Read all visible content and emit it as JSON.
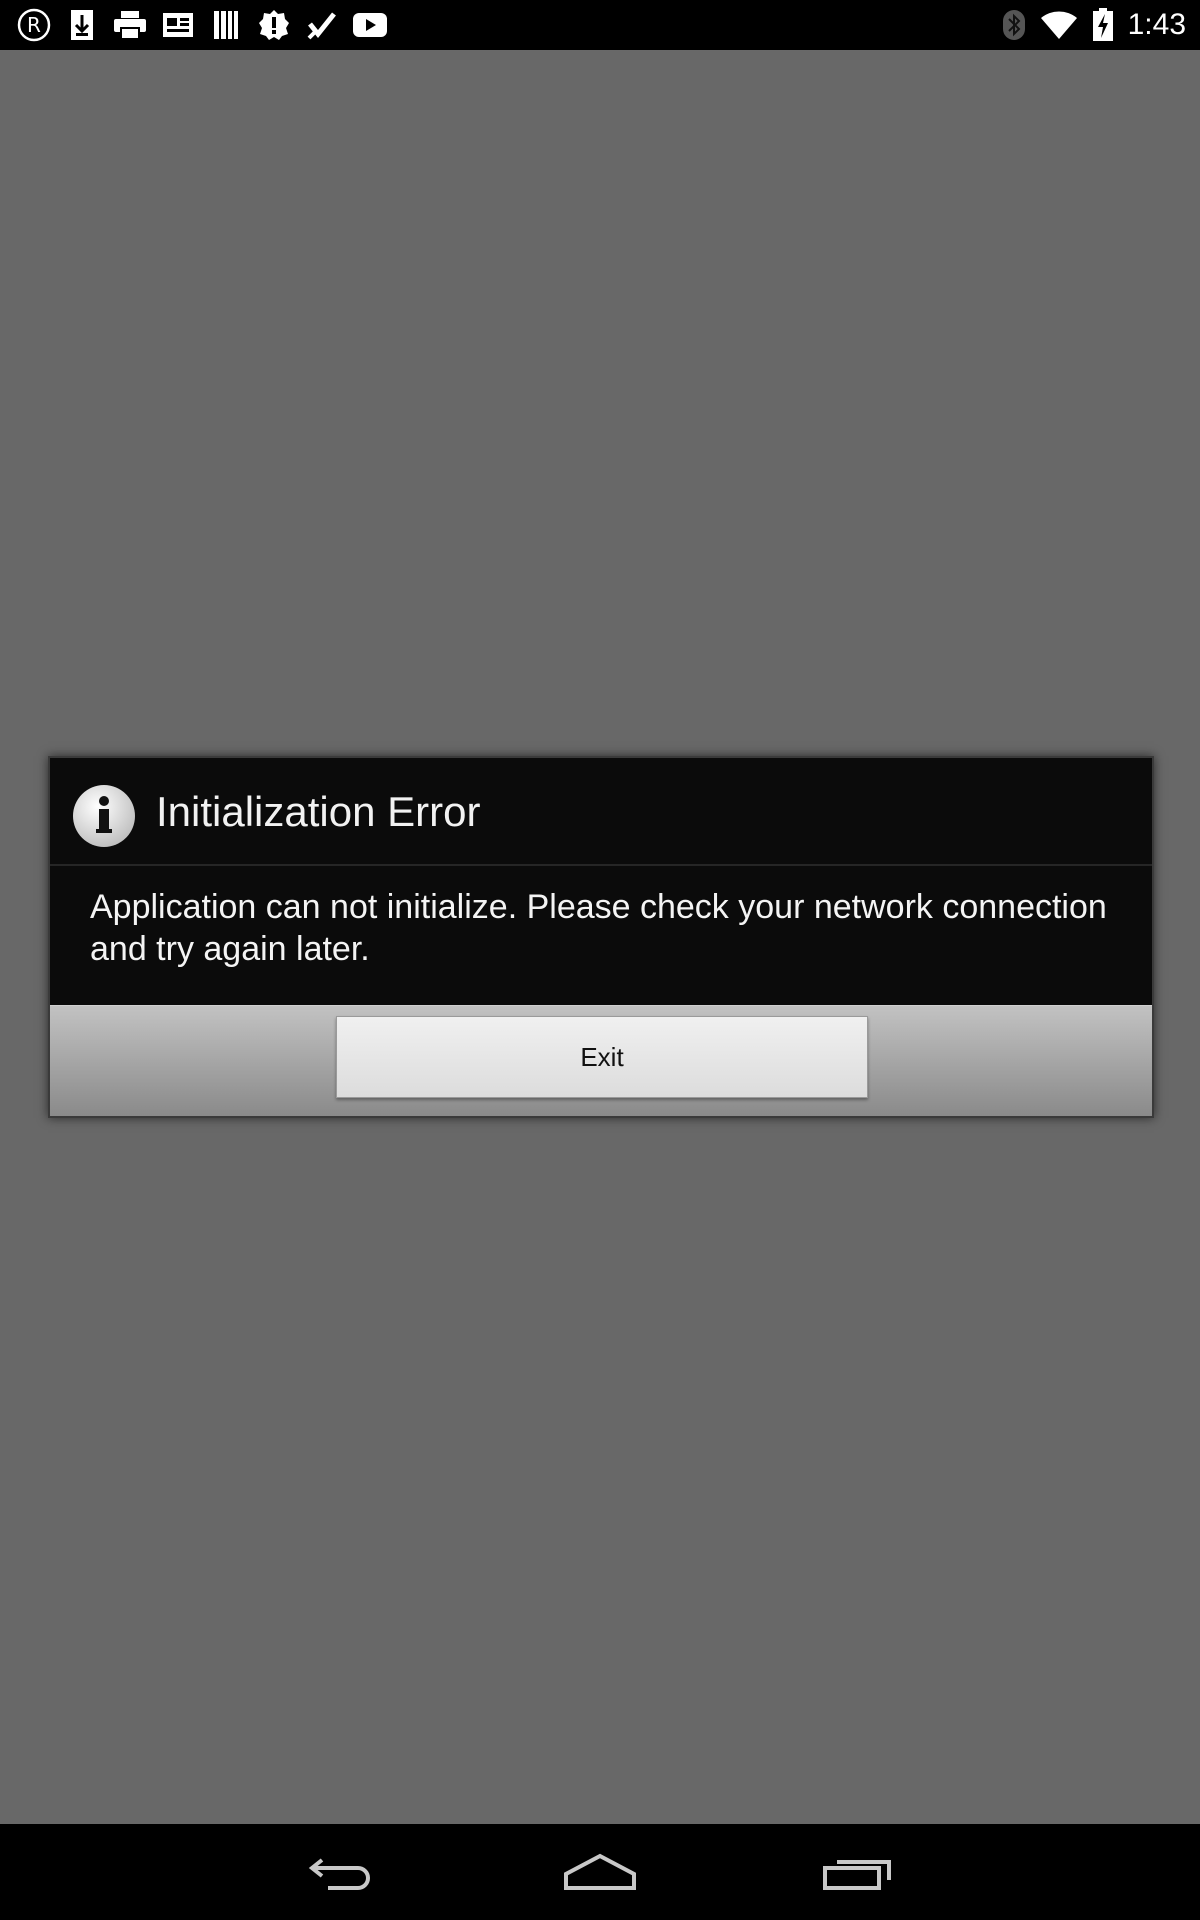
{
  "status_bar": {
    "time": "1:43",
    "notification_icons": [
      "registered-r-icon",
      "download-icon",
      "printer-icon",
      "news-icon",
      "library-icon",
      "alert-badge-icon",
      "checkmark-icon",
      "youtube-icon"
    ],
    "system_icons": [
      "bluetooth-icon",
      "wifi-icon",
      "battery-charging-icon"
    ]
  },
  "dialog": {
    "icon": "info-icon",
    "title": "Initialization Error",
    "message": "Application can not initialize. Please check your network connection and try again later.",
    "exit_label": "Exit"
  },
  "nav_bar": {
    "buttons": [
      "back-icon",
      "home-icon",
      "recent-apps-icon"
    ]
  },
  "colors": {
    "background": "#686868",
    "dialog_bg": "#0b0b0b",
    "bars": "#000000"
  }
}
